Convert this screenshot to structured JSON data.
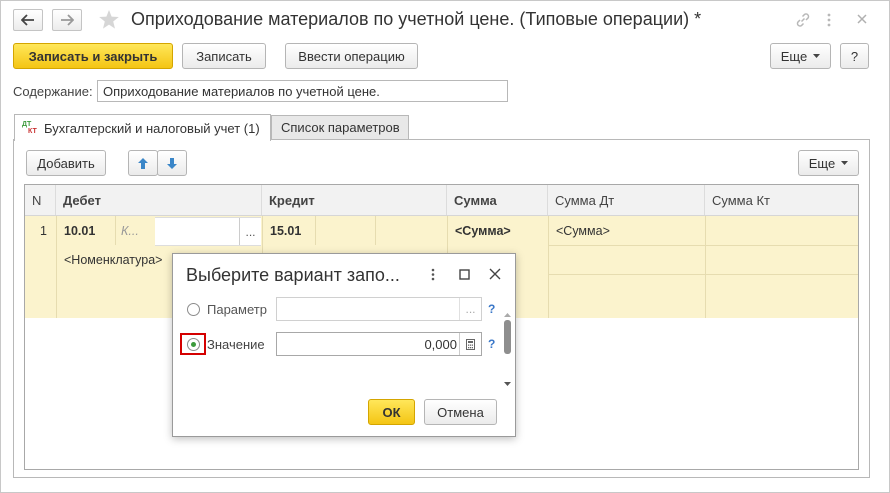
{
  "window": {
    "title": "Оприходование материалов по учетной цене. (Типовые операции) *"
  },
  "toolbar": {
    "save_close": "Записать и закрыть",
    "save": "Записать",
    "enter_operation": "Ввести операцию",
    "more": "Еще",
    "help": "?"
  },
  "content": {
    "label": "Содержание:",
    "value": "Оприходование материалов по учетной цене."
  },
  "tabs": [
    {
      "label": "Бухгалтерский и налоговый учет (1)",
      "icon": "dt-kt-icon"
    },
    {
      "label": "Список параметров"
    }
  ],
  "table_toolbar": {
    "add": "Добавить",
    "more": "Еще"
  },
  "table": {
    "columns": [
      "N",
      "Дебет",
      "Кредит",
      "Сумма",
      "Сумма Дт",
      "Сумма Кт"
    ],
    "row": {
      "n": "1",
      "debit_account": "10.01",
      "debit_sub": "К...",
      "debit_btn": "...",
      "credit_account": "15.01",
      "sum": "<Сумма>",
      "sum_dt": "<Сумма>",
      "subconto": "<Номенклатура>"
    }
  },
  "dialog": {
    "title": "Выберите вариант запо...",
    "param_label": "Параметр",
    "param_btn": "...",
    "value_label": "Значение",
    "value": "0,000",
    "help": "?",
    "ok": "ОК",
    "cancel": "Отмена",
    "selected": "Значение"
  },
  "colors": {
    "accent_yellow": "#f4c514",
    "row_highlight": "#fbf3cd",
    "highlight_box": "#d40000",
    "radio_selected": "#3c9a3c"
  }
}
